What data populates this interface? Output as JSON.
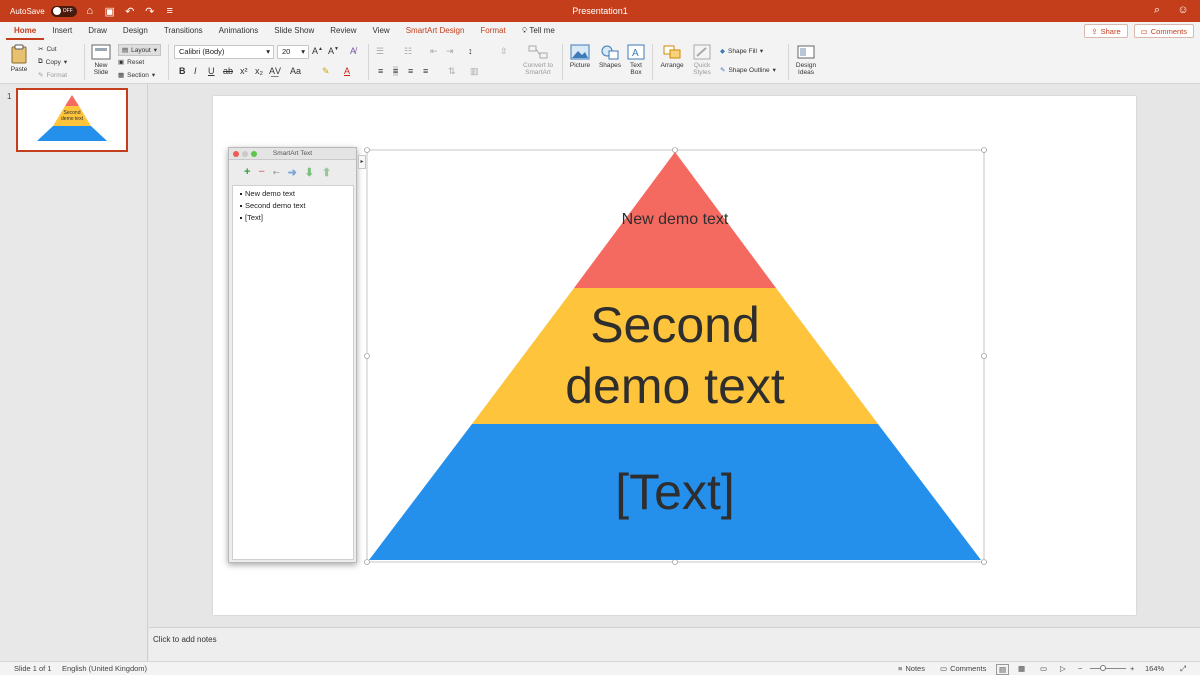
{
  "titlebar": {
    "autosave_label": "AutoSave",
    "autosave_state": "OFF",
    "doc_title": "Presentation1"
  },
  "tabs": [
    {
      "label": "Home",
      "active": true
    },
    {
      "label": "Insert"
    },
    {
      "label": "Draw"
    },
    {
      "label": "Design"
    },
    {
      "label": "Transitions"
    },
    {
      "label": "Animations"
    },
    {
      "label": "Slide Show"
    },
    {
      "label": "Review"
    },
    {
      "label": "View"
    },
    {
      "label": "SmartArt Design",
      "contextual": true
    },
    {
      "label": "Format",
      "contextual": true
    },
    {
      "label": "Tell me"
    }
  ],
  "actions": {
    "share": "Share",
    "comments": "Comments"
  },
  "ribbon": {
    "paste": "Paste",
    "cut": "Cut",
    "copy": "Copy",
    "format": "Format",
    "new_slide_1": "New",
    "new_slide_2": "Slide",
    "layout": "Layout",
    "reset": "Reset",
    "section": "Section",
    "font_name": "Calibri (Body)",
    "font_size": "20",
    "convert_1": "Convert to",
    "convert_2": "SmartArt",
    "picture": "Picture",
    "shapes": "Shapes",
    "textbox_1": "Text",
    "textbox_2": "Box",
    "arrange": "Arrange",
    "quick_styles_1": "Quick",
    "quick_styles_2": "Styles",
    "shape_fill": "Shape Fill",
    "shape_outline": "Shape Outline",
    "design_ideas_1": "Design",
    "design_ideas_2": "Ideas"
  },
  "thumbnail": {
    "number": "1",
    "text_1": "Second",
    "text_2": "demo text"
  },
  "smartart_pane": {
    "title": "SmartArt Text",
    "items": [
      "New demo text",
      "Second demo text",
      "[Text]"
    ]
  },
  "pyramid": {
    "top_text": "New demo text",
    "middle_text_1": "Second",
    "middle_text_2": "demo text",
    "bottom_text": "[Text]",
    "colors": {
      "top": "#f56a60",
      "middle": "#fdc43c",
      "bottom": "#2490ec",
      "text": "#2e2e2e"
    }
  },
  "notes_placeholder": "Click to add notes",
  "status": {
    "slide": "Slide 1 of 1",
    "language": "English (United Kingdom)",
    "notes": "Notes",
    "comments": "Comments",
    "zoom": "164%"
  }
}
